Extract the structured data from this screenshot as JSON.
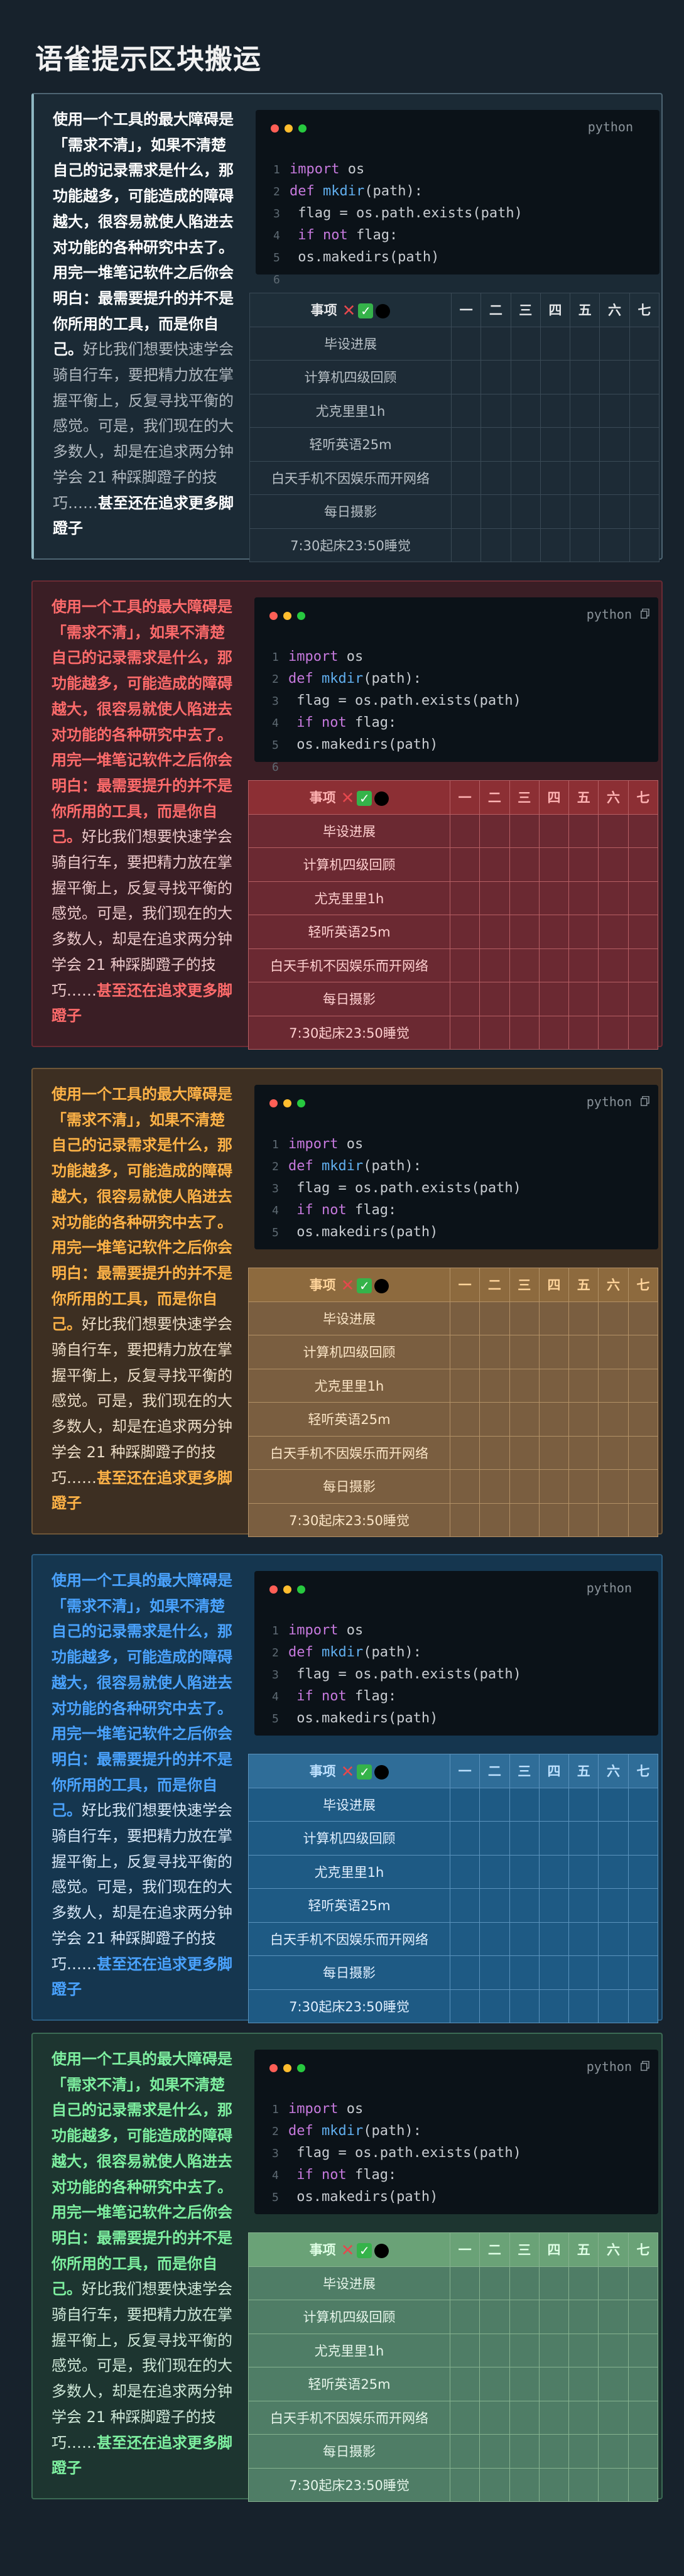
{
  "page": {
    "title": "语雀提示区块搬运"
  },
  "left_text": {
    "strong": "使用一个工具的最大障碍是「需求不清」，如果不清楚自己的记录需求是什么，那功能越多，可能造成的障碍越大，很容易就使人陷进去对功能的各种研究中去了。用完一堆笔记软件之后你会明白：最需要提升的并不是你所用的工具，而是你自己。",
    "normal": "好比我们想要快速学会骑自行车，要把精力放在掌握平衡上，反复寻找平衡的感觉。可是，我们现在的大多数人，却是在追求两分钟学会 21 种踩脚蹬子的技巧……",
    "strong_end": "甚至还在追求更多脚蹬子"
  },
  "code": {
    "lang": "python",
    "line_numbers": [
      "1",
      "2",
      "3",
      "4",
      "5",
      "6"
    ],
    "lines": [
      {
        "parts": [
          {
            "t": "import",
            "c": "kw"
          },
          {
            "t": " os",
            "c": "tx"
          }
        ]
      },
      {
        "parts": [
          {
            "t": "def",
            "c": "kw"
          },
          {
            "t": " ",
            "c": "tx"
          },
          {
            "t": "mkdir",
            "c": "fn"
          },
          {
            "t": "(path):",
            "c": "tx"
          }
        ]
      },
      {
        "parts": [
          {
            "t": "    flag = os.path.exists(path)",
            "c": "tx"
          }
        ]
      },
      {
        "parts": [
          {
            "t": "    ",
            "c": "tx"
          },
          {
            "t": "if not",
            "c": "kw"
          },
          {
            "t": " flag:",
            "c": "tx"
          }
        ]
      },
      {
        "parts": [
          {
            "t": "        os.makedirs(path)",
            "c": "tx"
          }
        ]
      },
      {
        "parts": []
      }
    ]
  },
  "table": {
    "header_first": "事项",
    "header_icons": [
      "cross-icon",
      "check-icon",
      "black-circle-icon"
    ],
    "days": [
      "一",
      "二",
      "三",
      "四",
      "五",
      "六",
      "七"
    ],
    "rows_first": [
      "毕设进展",
      "计算机四级回顾",
      "尤克里里1h",
      "轻听英语25m",
      "白天手机不因娱乐而开网络",
      "每日摄影",
      "7:30起床23:50睡觉"
    ],
    "rows_variant": [
      "毕设进展",
      "计算机四级回顾",
      "尤克里里1h",
      "轻听英语25m",
      "白天手机不因娱乐而开网络",
      "每日摄影",
      "7:30起床23:50睡觉"
    ]
  },
  "colors": {
    "slate": {
      "bg": "#1b2a35",
      "border": "#4e6573",
      "accent": "#ffffff",
      "text": "#b0b8bf",
      "th_bg": "#1e2e39",
      "td_bg": "#1d2b36",
      "th_text": "#e5e7e9",
      "td_text": "#b8c0c6"
    },
    "red": {
      "bg": "#3a1e25",
      "border": "#6a2b34",
      "accent": "#ff6b6b",
      "text": "#ecc9ca",
      "th_bg": "#8c2f34",
      "td_bg": "#6b2932",
      "th_text": "#ffb3b3",
      "td_text": "#ffd0d0",
      "tbl_border": "#b75f64"
    },
    "orange": {
      "bg": "#3d2f22",
      "border": "#6e5638",
      "accent": "#ffb347",
      "text": "#ecdcc6",
      "th_bg": "#8d6a3e",
      "td_bg": "#7a5e40",
      "th_text": "#ffd49a",
      "td_text": "#fbe5c6",
      "tbl_border": "#b39166"
    },
    "blue": {
      "bg": "#15364f",
      "border": "#2b5d82",
      "accent": "#4aa3ff",
      "text": "#d5e6f7",
      "th_bg": "#2f6d98",
      "td_bg": "#1e5a84",
      "th_text": "#bde1ff",
      "td_text": "#e0efff",
      "tbl_border": "#5b93bd"
    },
    "green": {
      "bg": "#1d3530",
      "border": "#3b6b54",
      "accent": "#7ef0a0",
      "text": "#cfe8d8",
      "th_bg": "#6aa277",
      "td_bg": "#4f7d66",
      "th_text": "#dfffe5",
      "td_text": "#e6f5ea",
      "tbl_border": "#86b28f"
    }
  }
}
